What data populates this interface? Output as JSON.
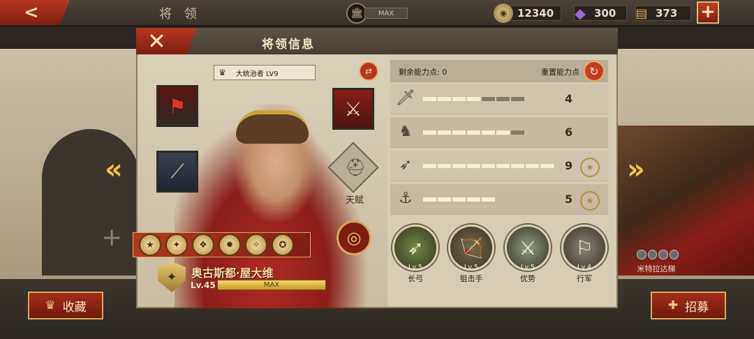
{
  "topbar": {
    "title": "将 领",
    "building_bar": "MAX",
    "coins": "12340",
    "gems": "300",
    "tickets": "373",
    "plus": "+"
  },
  "background": {
    "right_hero_name": "米特拉达梯",
    "fav_label": "收藏",
    "recruit_label": "招募"
  },
  "dialog": {
    "title": "将领信息",
    "close": "✕",
    "rank_badge": "大统治者 LV9",
    "talent_label": "天赋",
    "hero_name": "奥古斯都·屋大维",
    "hero_level": "Lv.45",
    "exp_text": "MAX"
  },
  "stats": {
    "points_label": "剩余能力点: 0",
    "reset_label": "重置能力点",
    "rows": [
      {
        "icon": "sword-icon",
        "value": "4",
        "filled": 4,
        "total": 7,
        "medal": false
      },
      {
        "icon": "horse-icon",
        "value": "6",
        "filled": 6,
        "total": 7,
        "medal": false
      },
      {
        "icon": "bow-icon",
        "value": "9",
        "filled": 9,
        "total": 9,
        "medal": true
      },
      {
        "icon": "anchor-icon",
        "value": "5",
        "filled": 5,
        "total": 5,
        "medal": true
      }
    ]
  },
  "skills": [
    {
      "name": "长弓",
      "level": "Lv.5",
      "icon": "bow-icon",
      "color": "#6f8a3e"
    },
    {
      "name": "狙击手",
      "level": "Lv.5",
      "icon": "archer-icon",
      "color": "#7a6a4a"
    },
    {
      "name": "优势",
      "level": "Lv.5",
      "icon": "archers-group-icon",
      "color": "#8a9a80"
    },
    {
      "name": "行军",
      "level": "Lv.4",
      "icon": "marching-icon",
      "color": "#8a8478"
    }
  ],
  "medals": [
    "★",
    "✦",
    "❖",
    "✹",
    "✧",
    "✪"
  ],
  "colors": {
    "accent_red": "#b8361f",
    "gold": "#d9a85a",
    "panel": "#d6ccb6"
  }
}
